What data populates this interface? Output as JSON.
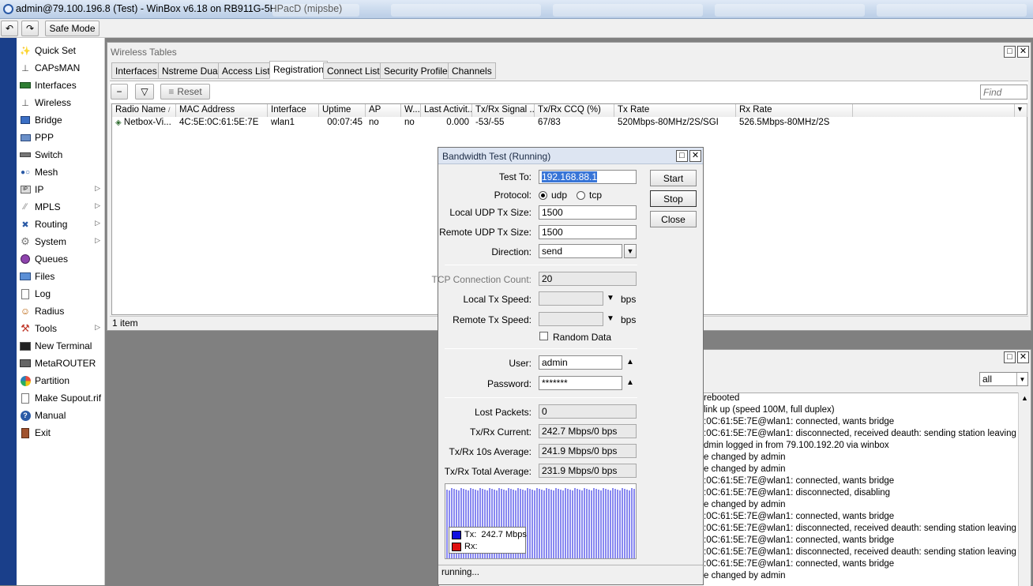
{
  "window": {
    "title": "admin@79.100.196.8 (Test) - WinBox v6.18 on RB911G-5HPacD (mipsbe)"
  },
  "toolbar": {
    "undo_icon": "undo-icon",
    "redo_icon": "redo-icon",
    "safe_mode_label": "Safe Mode"
  },
  "sidebar": {
    "items": [
      {
        "label": "Quick Set",
        "icon": "wand-icon",
        "submenu": false
      },
      {
        "label": "CAPsMAN",
        "icon": "antenna-icon",
        "submenu": false
      },
      {
        "label": "Interfaces",
        "icon": "interfaces-icon",
        "submenu": false
      },
      {
        "label": "Wireless",
        "icon": "wireless-icon",
        "submenu": false
      },
      {
        "label": "Bridge",
        "icon": "bridge-icon",
        "submenu": false
      },
      {
        "label": "PPP",
        "icon": "ppp-icon",
        "submenu": false
      },
      {
        "label": "Switch",
        "icon": "switch-icon",
        "submenu": false
      },
      {
        "label": "Mesh",
        "icon": "mesh-icon",
        "submenu": false
      },
      {
        "label": "IP",
        "icon": "ip-icon",
        "submenu": true
      },
      {
        "label": "MPLS",
        "icon": "mpls-icon",
        "submenu": true
      },
      {
        "label": "Routing",
        "icon": "routing-icon",
        "submenu": true
      },
      {
        "label": "System",
        "icon": "gear-icon",
        "submenu": true
      },
      {
        "label": "Queues",
        "icon": "queues-icon",
        "submenu": false
      },
      {
        "label": "Files",
        "icon": "folder-icon",
        "submenu": false
      },
      {
        "label": "Log",
        "icon": "log-icon",
        "submenu": false
      },
      {
        "label": "Radius",
        "icon": "radius-icon",
        "submenu": false
      },
      {
        "label": "Tools",
        "icon": "tools-icon",
        "submenu": true
      },
      {
        "label": "New Terminal",
        "icon": "terminal-icon",
        "submenu": false
      },
      {
        "label": "MetaROUTER",
        "icon": "metarouter-icon",
        "submenu": false
      },
      {
        "label": "Partition",
        "icon": "partition-icon",
        "submenu": false
      },
      {
        "label": "Make Supout.rif",
        "icon": "supout-icon",
        "submenu": false
      },
      {
        "label": "Manual",
        "icon": "help-icon",
        "submenu": false
      },
      {
        "label": "Exit",
        "icon": "exit-icon",
        "submenu": false
      }
    ]
  },
  "wireless_tables": {
    "title": "Wireless Tables",
    "tabs": [
      "Interfaces",
      "Nstreme Dual",
      "Access List",
      "Registration",
      "Connect List",
      "Security Profiles",
      "Channels"
    ],
    "active_tab": "Registration",
    "reset_label": "Reset",
    "find_placeholder": "Find",
    "columns": [
      "Radio Name",
      "MAC Address",
      "Interface",
      "Uptime",
      "AP",
      "W...",
      "Last Activit...",
      "Tx/Rx Signal ...",
      "Tx/Rx CCQ (%)",
      "Tx Rate",
      "Rx Rate"
    ],
    "rows": [
      [
        "Netbox-Vi...",
        "4C:5E:0C:61:5E:7E",
        "wlan1",
        "00:07:45",
        "no",
        "no",
        "0.000",
        "-53/-55",
        "67/83",
        "520Mbps-80MHz/2S/SGI",
        "526.5Mbps-80MHz/2S"
      ]
    ],
    "status": "1 item"
  },
  "bandwidth_test": {
    "title": "Bandwidth Test (Running)",
    "test_to_label": "Test To:",
    "test_to": "192.168.88.1",
    "protocol_label": "Protocol:",
    "protocol_options": [
      "udp",
      "tcp"
    ],
    "protocol_selected": "udp",
    "local_udp_label": "Local UDP Tx Size:",
    "local_udp": "1500",
    "remote_udp_label": "Remote UDP Tx Size:",
    "remote_udp": "1500",
    "direction_label": "Direction:",
    "direction": "send",
    "tcp_count_label": "TCP Connection Count:",
    "tcp_count": "20",
    "local_tx_label": "Local Tx Speed:",
    "remote_tx_label": "Remote Tx Speed:",
    "bps_unit": "bps",
    "random_data_label": "Random Data",
    "random_data_checked": false,
    "user_label": "User:",
    "user": "admin",
    "password_label": "Password:",
    "password": "*******",
    "lost_label": "Lost Packets:",
    "lost": "0",
    "current_label": "Tx/Rx Current:",
    "current": "242.7 Mbps/0 bps",
    "avg10_label": "Tx/Rx 10s Average:",
    "avg10": "241.9 Mbps/0 bps",
    "total_label": "Tx/Rx Total Average:",
    "total": "231.9 Mbps/0 bps",
    "start_label": "Start",
    "stop_label": "Stop",
    "close_label": "Close",
    "legend_tx": "Tx:  242.7 Mbps",
    "legend_rx": "Rx:",
    "tx_color": "#1010e0",
    "rx_color": "#e01010",
    "status": "running..."
  },
  "log": {
    "filter": "all",
    "lines": [
      "rebooted",
      " link up (speed 100M, full duplex)",
      ":0C:61:5E:7E@wlan1: connected, wants bridge",
      ":0C:61:5E:7E@wlan1: disconnected, received deauth: sending station leaving (3)",
      "dmin logged in from 79.100.192.20 via winbox",
      "e changed by admin",
      "e changed by admin",
      ":0C:61:5E:7E@wlan1: connected, wants bridge",
      ":0C:61:5E:7E@wlan1: disconnected, disabling",
      "e changed by admin",
      ":0C:61:5E:7E@wlan1: connected, wants bridge",
      ":0C:61:5E:7E@wlan1: disconnected, received deauth: sending station leaving (3)",
      ":0C:61:5E:7E@wlan1: connected, wants bridge",
      ":0C:61:5E:7E@wlan1: disconnected, received deauth: sending station leaving (3)",
      ":0C:61:5E:7E@wlan1: connected, wants bridge",
      "e changed by admin"
    ]
  }
}
